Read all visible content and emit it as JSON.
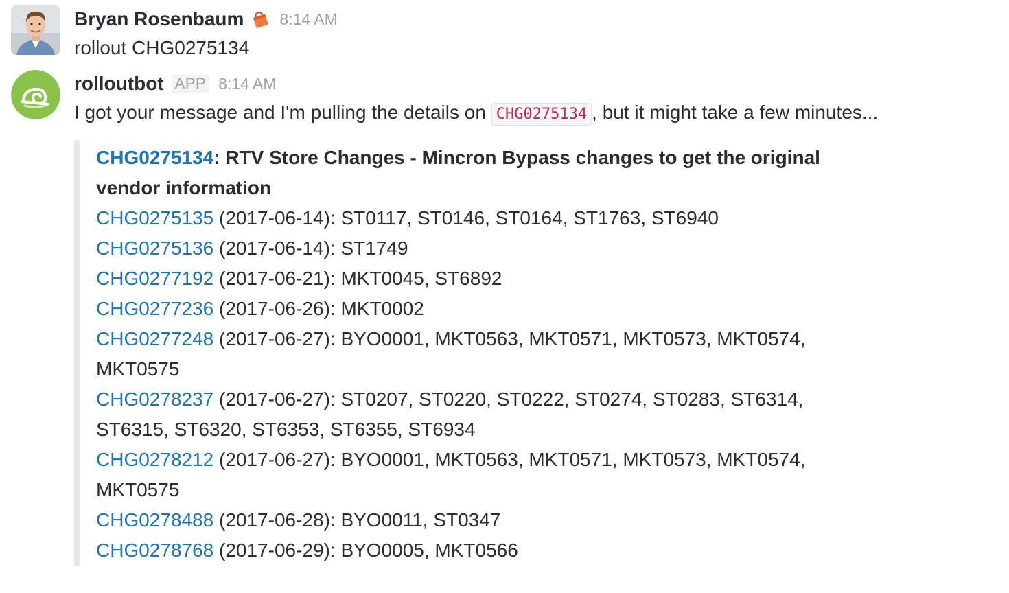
{
  "messages": [
    {
      "sender": "Bryan Rosenbaum",
      "time": "8:14 AM",
      "text": "rollout CHG0275134"
    },
    {
      "sender": "rolloutbot",
      "badge": "APP",
      "time": "8:14 AM",
      "text_before": "I got your message and I'm pulling the details on",
      "code": "CHG0275134",
      "text_after": ", but it might take a few minutes..."
    }
  ],
  "attachment": {
    "title_link": "CHG0275134",
    "title_rest": ": RTV Store Changes - Mincron Bypass changes to get the original vendor information",
    "changes": [
      {
        "id": "CHG0275135",
        "details": " (2017-06-14): ST0117, ST0146, ST0164, ST1763, ST6940"
      },
      {
        "id": "CHG0275136",
        "details": " (2017-06-14): ST1749"
      },
      {
        "id": "CHG0277192",
        "details": " (2017-06-21): MKT0045, ST6892"
      },
      {
        "id": "CHG0277236",
        "details": " (2017-06-26): MKT0002"
      },
      {
        "id": "CHG0277248",
        "details": " (2017-06-27): BYO0001, MKT0563, MKT0571, MKT0573, MKT0574, MKT0575"
      },
      {
        "id": "CHG0278237",
        "details": " (2017-06-27): ST0207, ST0220, ST0222, ST0274, ST0283, ST6314, ST6315, ST6320, ST6353, ST6355, ST6934"
      },
      {
        "id": "CHG0278212",
        "details": " (2017-06-27): BYO0001, MKT0563, MKT0571, MKT0573, MKT0574, MKT0575"
      },
      {
        "id": "CHG0278488",
        "details": " (2017-06-28): BYO0011, ST0347"
      },
      {
        "id": "CHG0278768",
        "details": " (2017-06-29): BYO0005, MKT0566"
      }
    ]
  },
  "colors": {
    "link": "#1d75b8",
    "bot_avatar": "#8bc34a",
    "code_text": "#c7254e"
  },
  "icons": {
    "user_avatar": "person-avatar-icon",
    "status_emoji": "shopping-bag-icon",
    "bot_avatar": "rolloutbot-logo-icon"
  }
}
